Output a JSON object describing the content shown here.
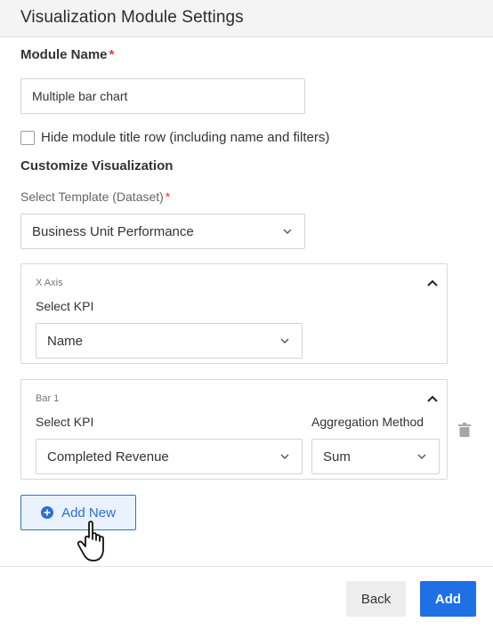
{
  "header": {
    "title": "Visualization Module Settings"
  },
  "module_name": {
    "label": "Module Name",
    "required_mark": "*",
    "value": "Multiple bar chart"
  },
  "hide_title_row": {
    "label": "Hide module title row (including name and filters)",
    "checked": false
  },
  "customize": {
    "heading": "Customize Visualization"
  },
  "template": {
    "label": "Select Template (Dataset)",
    "required_mark": "*",
    "selected": "Business Unit Performance"
  },
  "x_axis": {
    "section_label": "X Axis",
    "kpi_label": "Select KPI",
    "kpi_selected": "Name"
  },
  "bar1": {
    "section_label": "Bar 1",
    "kpi_label": "Select KPI",
    "kpi_selected": "Completed Revenue",
    "agg_label": "Aggregation Method",
    "agg_selected": "Sum"
  },
  "add_new": {
    "label": "Add New"
  },
  "footer": {
    "back_label": "Back",
    "add_label": "Add"
  },
  "colors": {
    "primary": "#1f6fe5",
    "required": "#e53935",
    "header_bg": "#f4f4f4"
  },
  "icons": {
    "chevron": "chevron-down-icon",
    "collapse": "chevron-up-icon",
    "delete": "trash-icon",
    "add": "plus-circle-icon",
    "cursor": "hand-pointer-icon"
  }
}
